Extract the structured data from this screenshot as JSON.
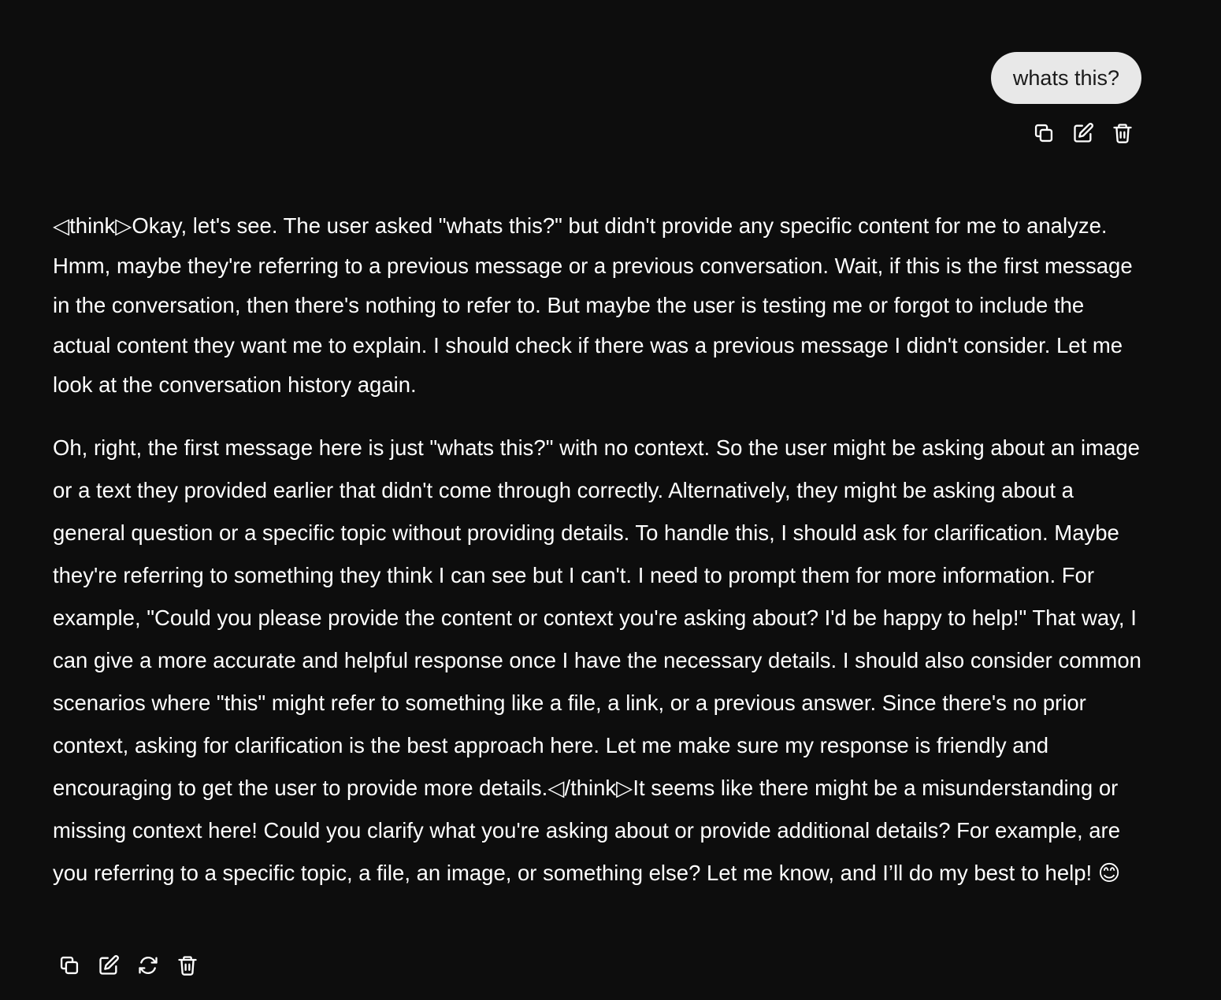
{
  "user_message": {
    "text": "whats this?"
  },
  "assistant_message": {
    "paragraph_1": "◁think▷Okay, let's see. The user asked \"whats this?\" but didn't provide any specific content for me to analyze. Hmm, maybe they're referring to a previous message or a previous conversation. Wait, if this is the first message in the conversation, then there's nothing to refer to. But maybe the user is testing me or forgot to include the actual content they want me to explain. I should check if there was a previous message I didn't consider. Let me look at the conversation history again.",
    "paragraph_2": "Oh, right, the first message here is just \"whats this?\" with no context. So the user might be asking about an image or a text they provided earlier that didn't come through correctly. Alternatively, they might be asking about a general question or a specific topic without providing details. To handle this, I should ask for clarification. Maybe they're referring to something they think I can see but I can't. I need to prompt them for more information. For example, \"Could you please provide the content or context you're asking about? I'd be happy to help!\" That way, I can give a more accurate and helpful response once I have the necessary details. I should also consider common scenarios where \"this\" might refer to something like a file, a link, or a previous answer. Since there's no prior context, asking for clarification is the best approach here. Let me make sure my response is friendly and encouraging to get the user to provide more details.◁/think▷It seems like there might be a misunderstanding or missing context here! Could you clarify what you're asking about or provide additional details? For example, are you referring to a specific topic, a file, an image, or something else? Let me know, and I’ll do my best to help! 😊"
  },
  "icons": {
    "user_actions": [
      "copy-icon",
      "edit-icon",
      "trash-icon"
    ],
    "assistant_actions": [
      "copy-icon",
      "edit-icon",
      "regenerate-icon",
      "trash-icon"
    ]
  },
  "colors": {
    "background": "#0d0d0d",
    "user_bubble": "#e8e8e8",
    "user_text": "#1a1a1a",
    "assistant_text": "#ffffff"
  }
}
